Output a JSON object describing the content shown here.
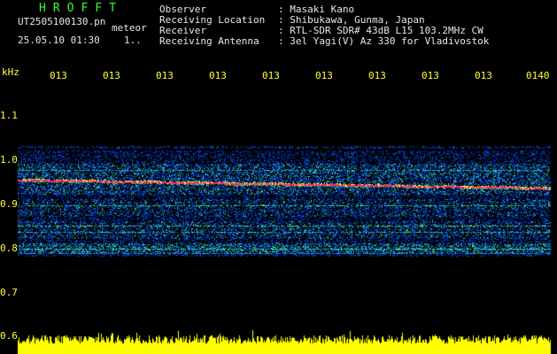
{
  "app": {
    "title": "HROFFT",
    "filename": "UT2505100130.pn",
    "meteor_label": "meteor",
    "datetime": "25.05.10 01:30",
    "count_short": "1.."
  },
  "info": {
    "labels": [
      "Observer",
      "Receiving Location",
      "Receiver",
      "Receiving Antenna"
    ],
    "values": [
      ": Masaki Kano",
      ": Shibukawa, Gunma, Japan",
      ": RTL-SDR SDR# 43dB L15 103.2MHz CW",
      ": 3el Yagi(V) Az 330 for Vladivostok"
    ]
  },
  "axis": {
    "unit": "kHz",
    "time_labels": [
      "013",
      "013",
      "013",
      "013",
      "013",
      "013",
      "013",
      "013",
      "013",
      "0140"
    ],
    "freq_labels": [
      "1.1",
      "1.0",
      "0.9",
      "0.8",
      "0.7",
      "0.6"
    ]
  },
  "colors": {
    "title": "#33ff33",
    "label_text": "#e8e8e8",
    "axis_text": "#ffff33",
    "background": "#000000",
    "echo_line": "#ff2a55",
    "noise_floor": "#ffff00"
  }
}
